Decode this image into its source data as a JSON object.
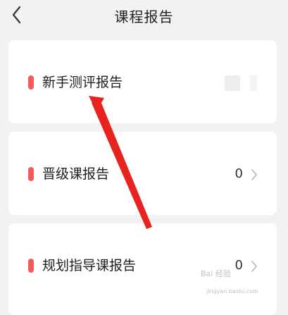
{
  "header": {
    "title": "课程报告",
    "back_icon": "chevron-left-icon"
  },
  "cards": [
    {
      "label": "新手测评报告",
      "count": "",
      "marker_color": "#f35b5b"
    },
    {
      "label": "晋级课报告",
      "count": "0",
      "marker_color": "#f35b5b"
    },
    {
      "label": "规划指导课报告",
      "count": "0",
      "marker_color": "#f35b5b"
    }
  ],
  "annotation": {
    "arrow_color": "#e8231f"
  },
  "watermark": {
    "text": "Bai 经验",
    "url": "jingyan.baidu.com"
  },
  "colors": {
    "background": "#f2f2f2",
    "card": "#ffffff",
    "accent": "#f35b5b"
  }
}
